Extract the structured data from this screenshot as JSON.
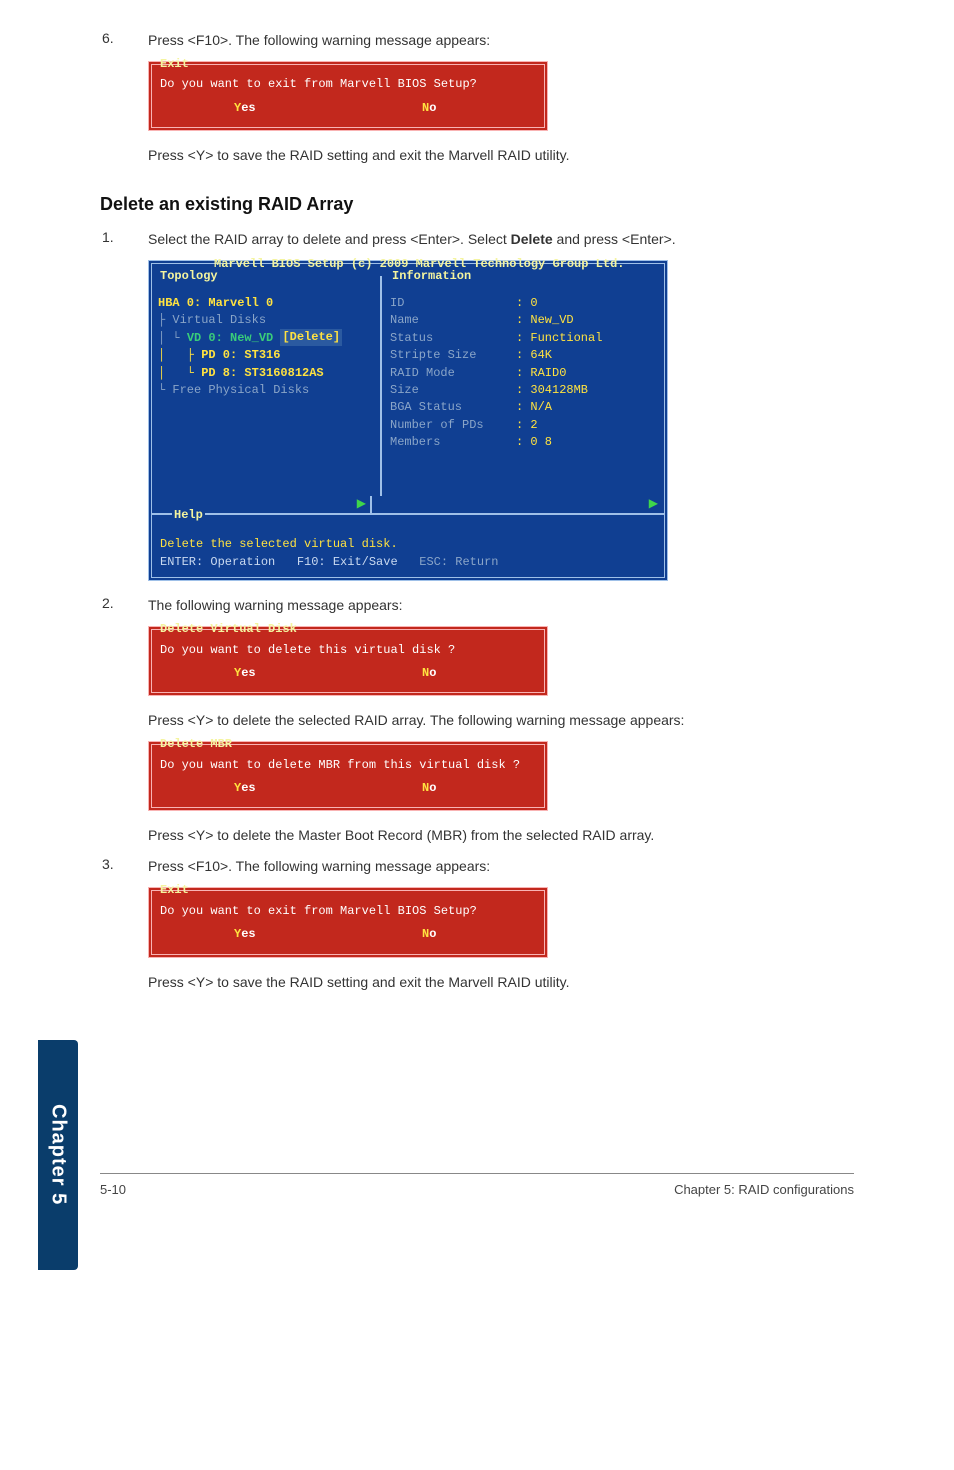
{
  "steps_top": {
    "num6": "6.",
    "text6": "Press <F10>. The following warning message appears:",
    "text6_after": "Press <Y> to save the RAID setting and exit the Marvell RAID utility."
  },
  "exit_box": {
    "title": "Exit",
    "msg": "Do you want to exit from Marvell BIOS Setup?",
    "yes_hot": "Y",
    "yes_rest": "es",
    "no_hot": "N",
    "no_rest": "o"
  },
  "section_heading": "Delete an existing RAID Array",
  "step1": {
    "num": "1.",
    "text_pre": "Select the RAID array to delete and press <Enter>. Select ",
    "text_bold": "Delete",
    "text_post": " and press <Enter>."
  },
  "bios_panel": {
    "title": "Marvell BIOS Setup (c) 2009 Marvell Technology Group Ltd.",
    "topology_label": "Topology",
    "information_label": "Information",
    "help_label": "Help",
    "tree": {
      "l0": "HBA 0: Marvell 0",
      "l1": "├ Virtual Disks",
      "l2_pre": "│ └ ",
      "l2_sel": "VD 0: New_VD",
      "l2_badge": "[Delete]",
      "l3": "│   ├ PD 0: ST316",
      "l4": "│   └ PD 8: ST3160812AS",
      "l5": "└ Free Physical Disks"
    },
    "info": [
      {
        "k": "ID",
        "v": ": 0"
      },
      {
        "k": "Name",
        "v": ": New_VD"
      },
      {
        "k": "Status",
        "v": ": Functional"
      },
      {
        "k": "Stripte Size",
        "v": ": 64K"
      },
      {
        "k": "RAID Mode",
        "v": ": RAID0"
      },
      {
        "k": "Size",
        "v": ": 304128MB"
      },
      {
        "k": "BGA Status",
        "v": ": N/A"
      },
      {
        "k": "Number of PDs",
        "v": ": 2"
      },
      {
        "k": "Members",
        "v": ": 0 8"
      }
    ],
    "arrow": "▶",
    "help_line1": "Delete the selected virtual disk.",
    "help_line2_a": "ENTER: Operation",
    "help_line2_b": "F10: Exit/Save",
    "help_line2_c": "ESC: Return"
  },
  "step2": {
    "num": "2.",
    "text_a": "The following warning message appears:",
    "text_b": "Press <Y> to delete the selected RAID array. The following warning message appears:",
    "text_c": "Press <Y> to delete the Master Boot Record (MBR) from the selected RAID array."
  },
  "delvd_box": {
    "title": "Delete Virtual Disk",
    "msg": "Do you want to delete this virtual disk ?",
    "yes_hot": "Y",
    "yes_rest": "es",
    "no_hot": "N",
    "no_rest": "o"
  },
  "delmbr_box": {
    "title": "Delete MBR",
    "msg": "Do you want to delete MBR from this virtual disk ?",
    "yes_hot": "Y",
    "yes_rest": "es",
    "no_hot": "N",
    "no_rest": "o"
  },
  "step3": {
    "num": "3.",
    "text_a": "Press <F10>. The following warning message appears:",
    "text_b": "Press <Y> to save the RAID setting and exit the Marvell RAID utility."
  },
  "exit_box2": {
    "title": "Exit",
    "msg": "Do you want to exit from Marvell BIOS Setup?",
    "yes_hot": "Y",
    "yes_rest": "es",
    "no_hot": "N",
    "no_rest": "o"
  },
  "chapter_tab": "Chapter 5",
  "footer": {
    "left": "5-10",
    "right": "Chapter 5: RAID configurations"
  }
}
